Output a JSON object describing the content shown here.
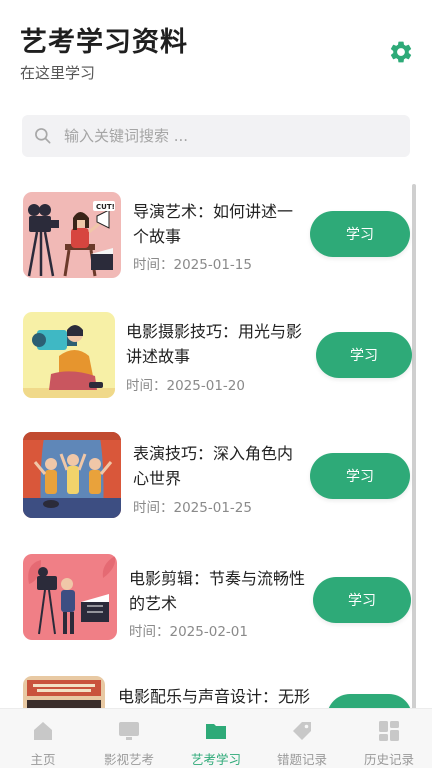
{
  "header": {
    "title": "艺考学习资料",
    "subtitle": "在这里学习",
    "settings_icon": "gear-icon"
  },
  "search": {
    "placeholder": "输入关键词搜索 ...",
    "value": "",
    "icon": "search-icon"
  },
  "colors": {
    "accent": "#2eaa78",
    "tab_inactive": "#9a9a9a",
    "search_bg": "#f2f2f4"
  },
  "list": {
    "items": [
      {
        "title": "导演艺术：如何讲述一个故事",
        "time": "时间：2025-01-15",
        "button": "学习",
        "thumbnail": "director-with-camera-illustration"
      },
      {
        "title": "电影摄影技巧：用光与影讲述故事",
        "time": "时间：2025-01-20",
        "button": "学习",
        "thumbnail": "cameraman-illustration"
      },
      {
        "title": "表演技巧：深入角色内心世界",
        "time": "时间：2025-01-25",
        "button": "学习",
        "thumbnail": "stage-performers-illustration"
      },
      {
        "title": "电影剪辑：节奏与流畅性的艺术",
        "time": "时间：2025-02-01",
        "button": "学习",
        "thumbnail": "film-crew-illustration"
      },
      {
        "title": "电影配乐与声音设计：无形",
        "time": "",
        "button": "学习",
        "thumbnail": "movie-poster-illustration"
      }
    ]
  },
  "tabbar": {
    "tabs": [
      {
        "label": "主页",
        "icon": "home-icon",
        "active": false
      },
      {
        "label": "影视艺考",
        "icon": "monitor-icon",
        "active": false
      },
      {
        "label": "艺考学习",
        "icon": "folder-icon",
        "active": true
      },
      {
        "label": "错题记录",
        "icon": "tag-icon",
        "active": false
      },
      {
        "label": "历史记录",
        "icon": "dashboard-icon",
        "active": false
      }
    ]
  }
}
